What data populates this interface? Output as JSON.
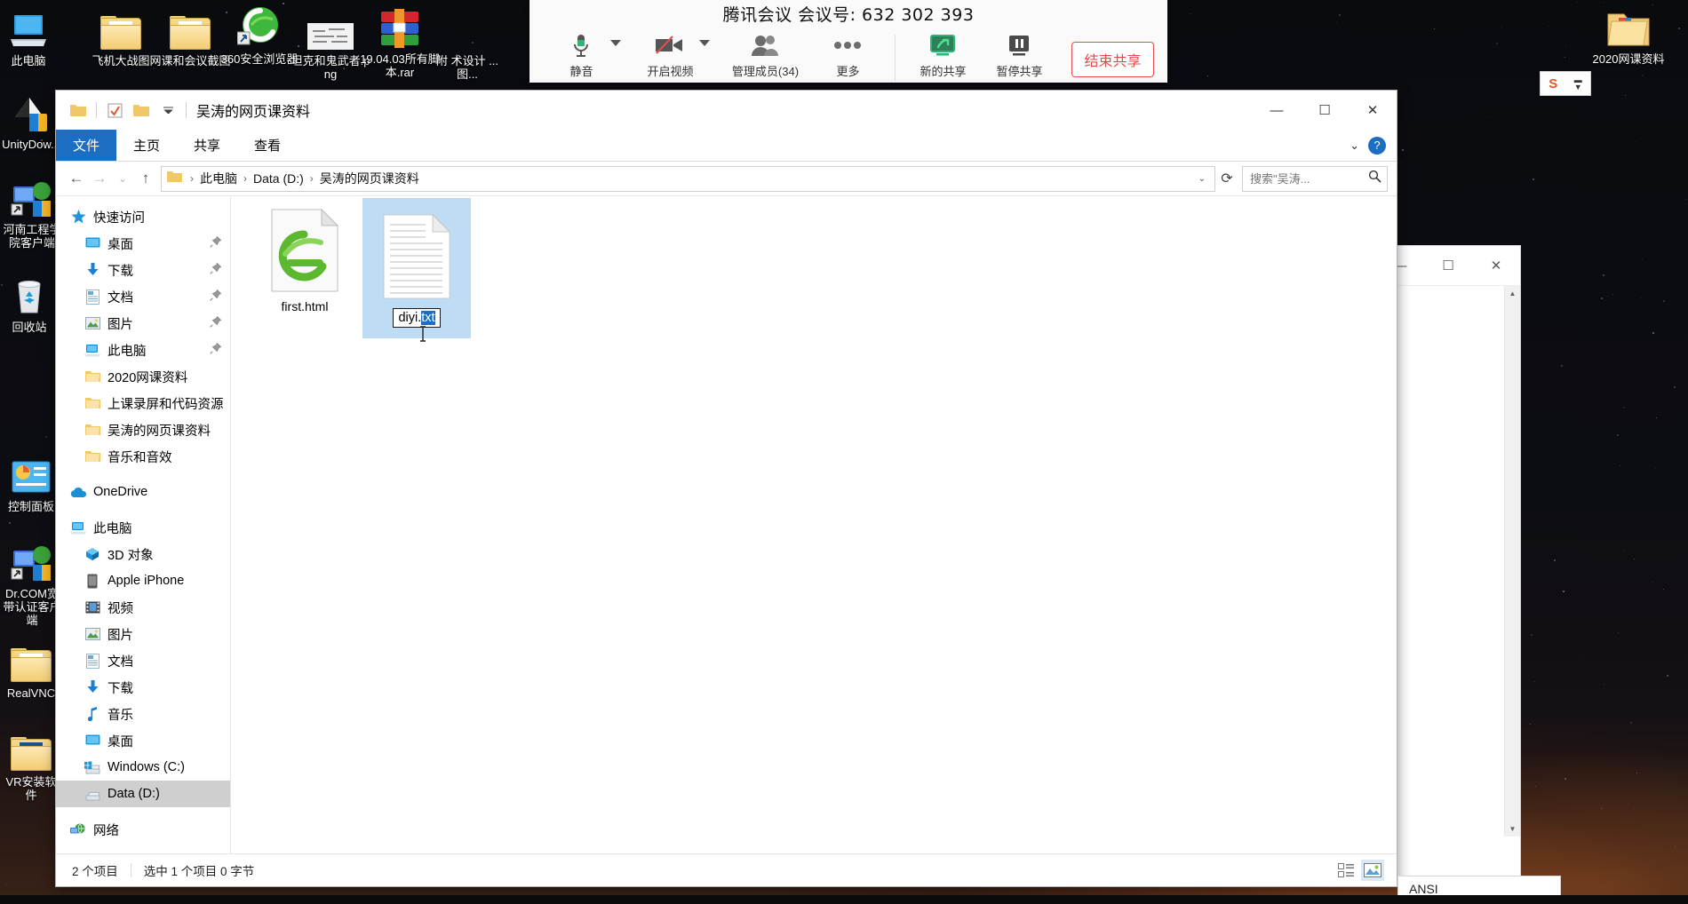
{
  "desktop": {
    "icons_left": [
      {
        "label": "此电脑",
        "icon": "this-pc-icon"
      },
      {
        "label": "UnityDow...",
        "icon": "unity-download-icon"
      },
      {
        "label": "河南工程学院客户端",
        "icon": "network-client-icon"
      },
      {
        "label": "回收站",
        "icon": "recycle-bin-icon"
      },
      {
        "label": "控制面板",
        "icon": "control-panel-icon"
      },
      {
        "label": "Dr.COM宽带认证客户端",
        "icon": "network-client-icon"
      },
      {
        "label": "RealVNC",
        "icon": "folder-icon"
      },
      {
        "label": "VR安装软件",
        "icon": "folder-icon"
      }
    ],
    "icons_top": [
      {
        "label": "飞机大战图",
        "icon": "folder-icon"
      },
      {
        "label": "网课和会议截图",
        "icon": "folder-icon"
      },
      {
        "label": "360安全浏览器",
        "icon": "browser-shortcut-icon"
      },
      {
        "label": "坦克和鬼武者.png",
        "icon": "image-file-icon"
      },
      {
        "label": "19.04.03所有脚本.rar",
        "icon": "rar-archive-icon"
      },
      {
        "label": "附 术设计 ...图...",
        "icon": "file-icon"
      }
    ],
    "icons_right": [
      {
        "label": "2020网课资料",
        "icon": "folder-icon"
      }
    ],
    "sogou_bar": "S"
  },
  "meeting": {
    "title": "腾讯会议 会议号: 632 302 393",
    "buttons": [
      {
        "label": "静音",
        "icon": "microphone-icon",
        "has_caret": true
      },
      {
        "label": "开启视频",
        "icon": "camera-off-icon",
        "has_caret": true
      },
      {
        "label": "管理成员(34)",
        "icon": "members-icon",
        "has_caret": false
      },
      {
        "label": "更多",
        "icon": "more-dots-icon",
        "has_caret": false
      },
      {
        "label": "新的共享",
        "icon": "share-screen-icon",
        "has_caret": false
      },
      {
        "label": "暂停共享",
        "icon": "pause-icon",
        "has_caret": false
      }
    ],
    "end_share_label": "结束共享",
    "accent_green": "#2bb673",
    "end_red": "#e34b4b"
  },
  "explorer": {
    "title": "吴涛的网页课资料",
    "quick_access_toolbar": [
      {
        "name": "folder-icon"
      },
      {
        "name": "properties-check-icon"
      },
      {
        "name": "new-folder-icon"
      },
      {
        "name": "customize-chevron-icon"
      }
    ],
    "window_controls": {
      "minimize": "—",
      "maximize": "☐",
      "close": "✕"
    },
    "ribbon_tabs": [
      {
        "label": "文件",
        "active": true
      },
      {
        "label": "主页",
        "active": false
      },
      {
        "label": "共享",
        "active": false
      },
      {
        "label": "查看",
        "active": false
      }
    ],
    "ribbon_right": {
      "collapse": "⌄",
      "help": "?"
    },
    "address": {
      "back": "←",
      "forward": "→",
      "recent": "⌄",
      "up": "↑",
      "crumbs": [
        "此电脑",
        "Data (D:)",
        "吴涛的网页课资料"
      ],
      "dropdown": "⌄",
      "refresh": "⟳"
    },
    "search": {
      "placeholder": "搜索\"吴涛...",
      "value": "",
      "icon": "search-icon"
    },
    "nav_pane": [
      {
        "label": "快速访问",
        "icon": "quick-access-star-icon",
        "level": 1,
        "pinned": false,
        "selected": false
      },
      {
        "label": "桌面",
        "icon": "desktop-icon",
        "level": 2,
        "pinned": true,
        "selected": false
      },
      {
        "label": "下载",
        "icon": "downloads-icon",
        "level": 2,
        "pinned": true,
        "selected": false
      },
      {
        "label": "文档",
        "icon": "documents-icon",
        "level": 2,
        "pinned": true,
        "selected": false
      },
      {
        "label": "图片",
        "icon": "pictures-icon",
        "level": 2,
        "pinned": true,
        "selected": false
      },
      {
        "label": "此电脑",
        "icon": "this-pc-icon",
        "level": 2,
        "pinned": true,
        "selected": false
      },
      {
        "label": "2020网课资料",
        "icon": "folder-icon",
        "level": 2,
        "pinned": false,
        "selected": false
      },
      {
        "label": "上课录屏和代码资源",
        "icon": "folder-icon",
        "level": 2,
        "pinned": false,
        "selected": false
      },
      {
        "label": "吴涛的网页课资料",
        "icon": "folder-icon",
        "level": 2,
        "pinned": false,
        "selected": false
      },
      {
        "label": "音乐和音效",
        "icon": "folder-icon",
        "level": 2,
        "pinned": false,
        "selected": false
      },
      {
        "label": "OneDrive",
        "icon": "onedrive-cloud-icon",
        "level": 1,
        "pinned": false,
        "selected": false
      },
      {
        "label": "此电脑",
        "icon": "this-pc-icon",
        "level": 1,
        "pinned": false,
        "selected": false
      },
      {
        "label": "3D 对象",
        "icon": "3d-objects-icon",
        "level": 2,
        "pinned": false,
        "selected": false
      },
      {
        "label": "Apple iPhone",
        "icon": "phone-icon",
        "level": 2,
        "pinned": false,
        "selected": false
      },
      {
        "label": "视频",
        "icon": "videos-icon",
        "level": 2,
        "pinned": false,
        "selected": false
      },
      {
        "label": "图片",
        "icon": "pictures-icon",
        "level": 2,
        "pinned": false,
        "selected": false
      },
      {
        "label": "文档",
        "icon": "documents-icon",
        "level": 2,
        "pinned": false,
        "selected": false
      },
      {
        "label": "下载",
        "icon": "downloads-icon",
        "level": 2,
        "pinned": false,
        "selected": false
      },
      {
        "label": "音乐",
        "icon": "music-note-icon",
        "level": 2,
        "pinned": false,
        "selected": false
      },
      {
        "label": "桌面",
        "icon": "desktop-icon",
        "level": 2,
        "pinned": false,
        "selected": false
      },
      {
        "label": "Windows (C:)",
        "icon": "windows-drive-icon",
        "level": 2,
        "pinned": false,
        "selected": false
      },
      {
        "label": "Data (D:)",
        "icon": "drive-icon",
        "level": 2,
        "pinned": false,
        "selected": true
      },
      {
        "label": "网络",
        "icon": "network-icon",
        "level": 1,
        "pinned": false,
        "selected": false
      }
    ],
    "files": [
      {
        "name": "first.html",
        "icon": "ie-html-file-icon",
        "selected": false,
        "renaming": false
      },
      {
        "name": "diyi.txt",
        "icon": "text-file-icon",
        "selected": true,
        "renaming": true,
        "rename_stem": "diyi.",
        "rename_selected_part": "txt"
      }
    ],
    "status": {
      "count": "2 个项目",
      "selection": "选中 1 个项目  0 字节",
      "view_details_icon": "details-view-icon",
      "view_large_icon": "large-icons-view-icon"
    }
  },
  "background_window": {
    "controls": {
      "minimize": "—",
      "maximize": "☐",
      "close": "✕"
    },
    "scroll_up": "▲",
    "scroll_down": "▼"
  },
  "ansi_box": {
    "label": "ANSI"
  },
  "colors": {
    "accent_blue": "#1b6ec2",
    "selection_blue": "#bfdcf5",
    "nav_selected_gray": "#cfcfcf"
  }
}
